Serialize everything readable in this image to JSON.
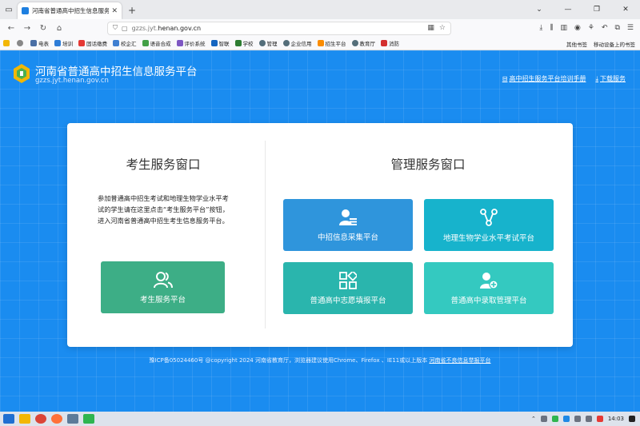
{
  "browser": {
    "tab_title": "河南省普通高中招生信息服务平台",
    "tab_close": "✕",
    "new_tab": "+",
    "url_host_prefix": "gzzs.jyt.",
    "url_host_main": "henan.gov.cn",
    "window_controls": [
      "⌄",
      "—",
      "❐",
      "✕"
    ]
  },
  "bookmarks": {
    "items": [
      {
        "label": "电表",
        "color": "#4a6fa5"
      },
      {
        "label": "培训",
        "color": "#2e7dd7"
      },
      {
        "label": "固话缴费",
        "color": "#e53935"
      },
      {
        "label": "校企汇",
        "color": "#3f7fd1"
      },
      {
        "label": "语音合成",
        "color": "#43a047"
      },
      {
        "label": "评价系统",
        "color": "#7e57c2"
      },
      {
        "label": "智联",
        "color": "#1565c0"
      },
      {
        "label": "学校",
        "color": "#2e7d32"
      },
      {
        "label": "管理",
        "color": "#546e7a"
      },
      {
        "label": "企业信用",
        "color": "#546e7a"
      },
      {
        "label": "招生平台",
        "color": "#fb8c00"
      },
      {
        "label": "教育厅",
        "color": "#546e7a"
      },
      {
        "label": "消防",
        "color": "#d32f2f"
      }
    ],
    "other": "其他书签",
    "mobile": "移动设备上的书签"
  },
  "site": {
    "title": "河南省普通高中招生信息服务平台",
    "domain": "gzzs.jyt.henan.gov.cn",
    "link_manual": "高中招生服务平台培训手册",
    "link_download": "下载服务"
  },
  "student": {
    "title": "考生服务窗口",
    "desc": "参加普通高中招生考试和地理生物学业水平考试的学生请在这里点击“考生服务平台”按钮，进入河南省普通高中招生考生信息服务平台。",
    "button": "考生服务平台"
  },
  "admin": {
    "title": "管理服务窗口",
    "buttons": [
      {
        "label": "中招信息采集平台",
        "color": "#2f95dc"
      },
      {
        "label": "地理生物学业水平考试平台",
        "color": "#17b3cc"
      },
      {
        "label": "普通高中志愿填报平台",
        "color": "#2ab5ad"
      },
      {
        "label": "普通高中录取管理平台",
        "color": "#34c9c0"
      }
    ]
  },
  "footer": {
    "text": "豫ICP备05024460号 @copyright 2024 河南省教育厅，浏览器建议使用Chrome、Firefox 、IE11或以上版本",
    "link": "河南省不良信息举报平台"
  },
  "taskbar": {
    "time": "14:03"
  }
}
